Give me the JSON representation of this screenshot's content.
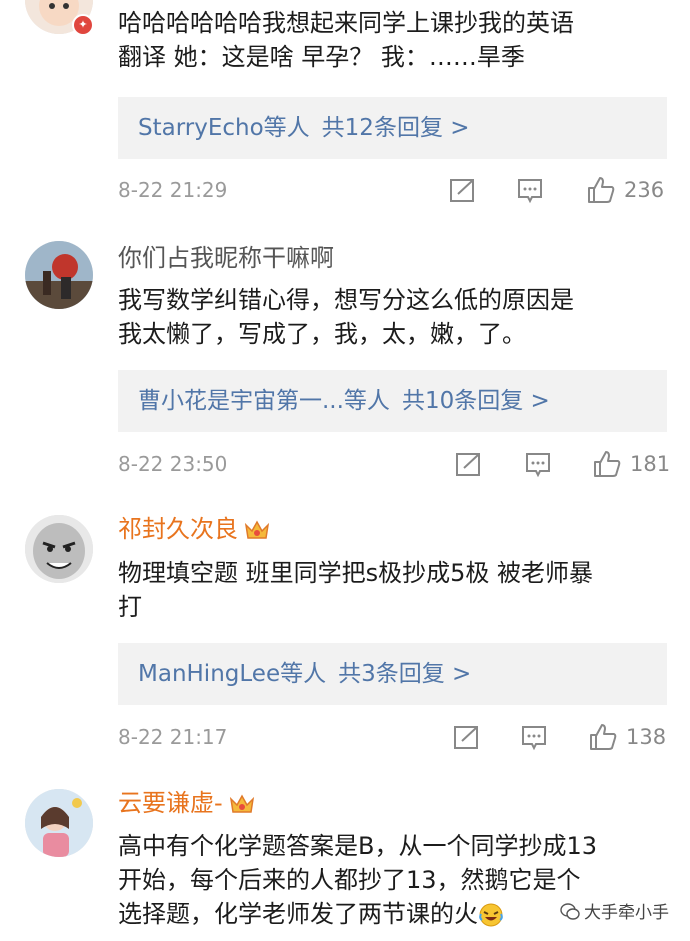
{
  "comments": [
    {
      "username": "",
      "lines": [
        "哈哈哈哈哈哈我想起来同学上课抄我的英语",
        "翻译 她：这是啥 早孕？   我：……旱季"
      ],
      "reply_users": "StarryEcho等人",
      "reply_count": "共12条回复 >",
      "time": "8-22 21:29",
      "likes": "236"
    },
    {
      "username": "你们占我昵称干嘛啊",
      "lines": [
        "我写数学纠错心得，想写分这么低的原因是",
        "我太懒了，写成了，我，太，嫩，了。"
      ],
      "reply_users": "曹小花是宇宙第一...等人",
      "reply_count": "共10条回复 >",
      "time": "8-22 23:50",
      "likes": "181"
    },
    {
      "username": "祁封久次良",
      "lines": [
        "物理填空题 班里同学把s极抄成5极 被老师暴",
        "打"
      ],
      "reply_users": "ManHingLee等人",
      "reply_count": "共3条回复 >",
      "time": "8-22 21:17",
      "likes": "138"
    },
    {
      "username": "云要谦虚-",
      "lines": [
        "高中有个化学题答案是B，从一个同学抄成13",
        "开始，每个后来的人都抄了13，然鹅它是个",
        "选择题，化学老师发了两节课的火"
      ]
    }
  ],
  "watermark": "大手牵小手",
  "colors": {
    "link": "#5176a8",
    "vip_name": "#e8741e",
    "reply_bg": "#f2f2f2"
  }
}
